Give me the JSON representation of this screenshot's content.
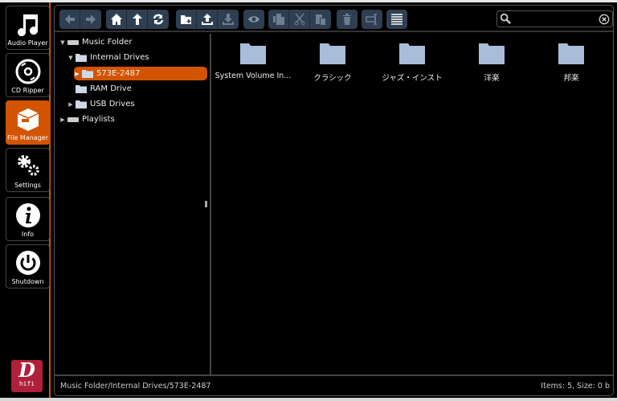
{
  "sidebar": {
    "items": [
      {
        "label": "Audio Player",
        "icon": "music-note-icon"
      },
      {
        "label": "CD Ripper",
        "icon": "disc-icon"
      },
      {
        "label": "File Manager",
        "icon": "box-icon",
        "active": true
      },
      {
        "label": "Settings",
        "icon": "gears-icon"
      },
      {
        "label": "Info",
        "icon": "info-icon"
      },
      {
        "label": "Shutdown",
        "icon": "power-icon"
      }
    ],
    "logo": "hifi"
  },
  "toolbar": {
    "buttons": [
      "back",
      "forward",
      "home",
      "up",
      "refresh",
      "new-folder",
      "upload",
      "download",
      "preview",
      "copy",
      "cut",
      "paste",
      "delete",
      "rename",
      "list-view"
    ],
    "search_value": ""
  },
  "tree": {
    "items": [
      {
        "label": "Music Folder",
        "level": 0,
        "expanded": true
      },
      {
        "label": "Internal Drives",
        "level": 1,
        "expanded": true
      },
      {
        "label": "573E-2487",
        "level": 2,
        "selected": true
      },
      {
        "label": "RAM Drive",
        "level": 1
      },
      {
        "label": "USB Drives",
        "level": 1
      },
      {
        "label": "Playlists",
        "level": 0
      }
    ]
  },
  "content": {
    "items": [
      {
        "label": "System Volume In..."
      },
      {
        "label": "クラシック"
      },
      {
        "label": "ジャズ・インスト"
      },
      {
        "label": "洋楽"
      },
      {
        "label": "邦楽"
      }
    ]
  },
  "status": {
    "path": "Music Folder/Internal Drives/573E-2487",
    "summary": "Items: 5, Size: 0 b"
  },
  "colors": {
    "accent": "#d35400",
    "toolbar_button": "#2f3f52",
    "folder": "#a9bcd8",
    "logo": "#b0203a"
  }
}
